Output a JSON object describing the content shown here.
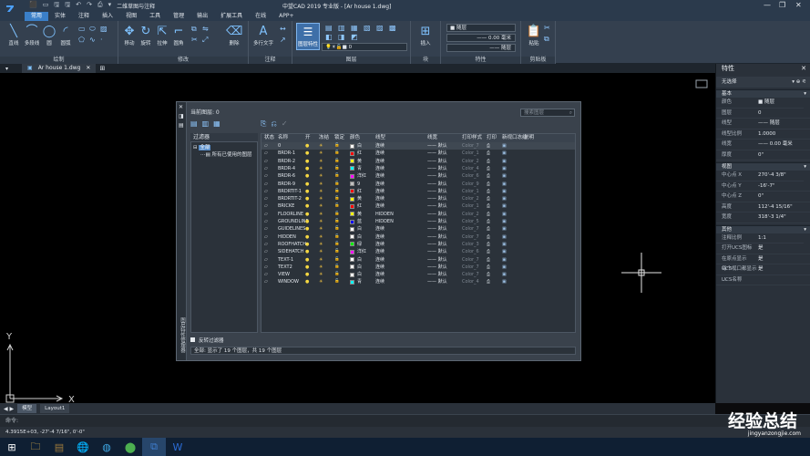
{
  "titlebar": {
    "workspace": "二维草图与注释",
    "title": "中望CAD 2019 专业版 - [Ar house 1.dwg]",
    "quick": [
      "⬛",
      "▭",
      "🖫",
      "🖫",
      "↶",
      "↷",
      "⎙",
      "▾"
    ]
  },
  "menu": [
    "常用",
    "实体",
    "注释",
    "插入",
    "视图",
    "工具",
    "管理",
    "输出",
    "扩展工具",
    "在线",
    "APP+"
  ],
  "ribbon": {
    "draw": {
      "title": "绘制",
      "tools": [
        "直线",
        "多段线",
        "圆",
        "圆弧"
      ]
    },
    "modify": {
      "title": "修改",
      "tools": [
        "移动",
        "旋转",
        "拉伸",
        "圆角",
        "删除"
      ]
    },
    "annotate": {
      "title": "注释",
      "tools": [
        "多行文字"
      ]
    },
    "layer": {
      "title": "图层",
      "tool": "图层特性",
      "current": "0"
    },
    "block": {
      "title": "块",
      "tool": "插入"
    },
    "props": {
      "title": "特性",
      "color": "随层",
      "linetype": "随层",
      "lineweight": "0.00 毫米"
    },
    "clipboard": {
      "title": "剪贴板",
      "tool": "粘贴"
    }
  },
  "doctab": {
    "label": "Ar house 1.dwg"
  },
  "properties": {
    "title": "特性",
    "selection": "无选择",
    "sections": [
      {
        "name": "基本",
        "rows": [
          [
            "颜色",
            "■ 随层"
          ],
          [
            "图层",
            "0"
          ],
          [
            "线型",
            "—— 随层"
          ],
          [
            "线型比例",
            "1.0000"
          ],
          [
            "线宽",
            "—— 0.00 毫米"
          ],
          [
            "厚度",
            "0\""
          ]
        ]
      },
      {
        "name": "视图",
        "rows": [
          [
            "中心点 X",
            "270'-4 3/8\""
          ],
          [
            "中心点 Y",
            "-16'-7\""
          ],
          [
            "中心点 Z",
            "0\""
          ],
          [
            "高度",
            "112'-4 15/16\""
          ],
          [
            "宽度",
            "318'-3 1/4\""
          ]
        ]
      },
      {
        "name": "其他",
        "rows": [
          [
            "注释比例",
            "1:1"
          ],
          [
            "打开UCS图标",
            "是"
          ],
          [
            "在原点显示 UCS...",
            "是"
          ],
          [
            "每个视口都显示 ...",
            "是"
          ],
          [
            "UCS名称",
            ""
          ]
        ]
      }
    ]
  },
  "dialog": {
    "current_layer": "当前图层: 0",
    "search_placeholder": "搜索图层",
    "sidebar_title": "图层特性管理器",
    "filter_header": "过滤器",
    "filter_all": "全部",
    "filter_used": "所有已使用的图层",
    "columns": [
      "状态",
      "名称",
      "开",
      "冻结",
      "锁定",
      "颜色",
      "线型",
      "线宽",
      "打印样式",
      "打印",
      "新视口冻结",
      "说明"
    ],
    "layers": [
      {
        "name": "0",
        "color": "白",
        "hex": "#ffffff",
        "linetype": "连续",
        "style": "Color_7"
      },
      {
        "name": "BRDR-1",
        "color": "红",
        "hex": "#ff0000",
        "linetype": "连续",
        "style": "Color_1"
      },
      {
        "name": "BRDR-2",
        "color": "黄",
        "hex": "#ffff00",
        "linetype": "连续",
        "style": "Color_2"
      },
      {
        "name": "BRDR-4",
        "color": "青",
        "hex": "#00ffff",
        "linetype": "连续",
        "style": "Color_4"
      },
      {
        "name": "BRDR-6",
        "color": "洋红",
        "hex": "#ff00ff",
        "linetype": "连续",
        "style": "Color_6"
      },
      {
        "name": "BRDR-9",
        "color": "9",
        "hex": "#c0c0c0",
        "linetype": "连续",
        "style": "Color_9"
      },
      {
        "name": "BRDRTIT-1",
        "color": "红",
        "hex": "#ff0000",
        "linetype": "连续",
        "style": "Color_1"
      },
      {
        "name": "BRDRTIT-2",
        "color": "黄",
        "hex": "#ffff00",
        "linetype": "连续",
        "style": "Color_2"
      },
      {
        "name": "BRICKE",
        "color": "红",
        "hex": "#ff0000",
        "linetype": "连续",
        "style": "Color_1"
      },
      {
        "name": "FLOORLINE",
        "color": "黄",
        "hex": "#ffff00",
        "linetype": "HIDDEN",
        "style": "Color_2"
      },
      {
        "name": "GROUNDLINE",
        "color": "蓝",
        "hex": "#0000ff",
        "linetype": "HIDDEN",
        "style": "Color_5"
      },
      {
        "name": "GUIDELINES",
        "color": "白",
        "hex": "#ffffff",
        "linetype": "连续",
        "style": "Color_7"
      },
      {
        "name": "HIDDEN",
        "color": "白",
        "hex": "#ffffff",
        "linetype": "连续",
        "style": "Color_7"
      },
      {
        "name": "ROOFHATCH",
        "color": "绿",
        "hex": "#00ff00",
        "linetype": "连续",
        "style": "Color_3"
      },
      {
        "name": "SIDEHATCH",
        "color": "洋红",
        "hex": "#ff00ff",
        "linetype": "连续",
        "style": "Color_6"
      },
      {
        "name": "TEXT-1",
        "color": "白",
        "hex": "#ffffff",
        "linetype": "连续",
        "style": "Color_7"
      },
      {
        "name": "TEXT2",
        "color": "白",
        "hex": "#ffffff",
        "linetype": "连续",
        "style": "Color_7"
      },
      {
        "name": "VIEW",
        "color": "白",
        "hex": "#ffffff",
        "linetype": "连续",
        "style": "Color_7"
      },
      {
        "name": "WINDOW",
        "color": "青",
        "hex": "#00ffff",
        "linetype": "连续",
        "style": "Color_4"
      }
    ],
    "lineweight_value": "默认",
    "invert_filter": "反转过滤器",
    "summary": "全部: 显示了 19 个图层，共 19 个图层"
  },
  "layouts": [
    "模型",
    "Layout1"
  ],
  "command_prompt": "命令:",
  "status_coords": "4.3915E+03, -27'-4 7/16\", 0'-0\"",
  "watermark": {
    "text": "经验总结",
    "url": "jingyanzongjie.com"
  },
  "taskbar": [
    "⊞",
    "🗀",
    "▤",
    "🌐",
    "◍",
    "⬤",
    "⧉",
    "W"
  ]
}
